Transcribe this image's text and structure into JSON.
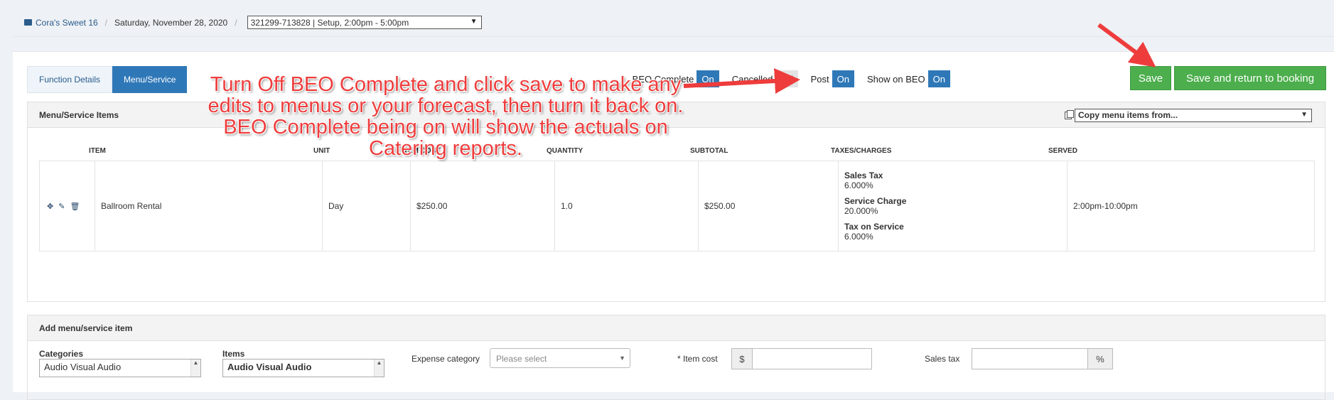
{
  "breadcrumb": {
    "booking": "Cora's Sweet 16",
    "date": "Saturday, November 28, 2020",
    "function_select": "321299-713828 | Setup, 2:00pm - 5:00pm"
  },
  "tabs": [
    {
      "label": "Function Details",
      "active": false
    },
    {
      "label": "Menu/Service",
      "active": true
    }
  ],
  "toggles": [
    {
      "label": "BEO Complete",
      "state": "On"
    },
    {
      "label": "Cancelled",
      "state": "Off"
    },
    {
      "label": "Post",
      "state": "On"
    },
    {
      "label": "Show on BEO",
      "state": "On"
    }
  ],
  "buttons": {
    "save": "Save",
    "save_return": "Save and return to booking"
  },
  "menu_panel": {
    "title": "Menu/Service Items",
    "copy_select": "Copy menu items from...",
    "columns": [
      "ITEM",
      "UNIT",
      "ITEM COST",
      "QUANTITY",
      "SUBTOTAL",
      "TAXES/CHARGES",
      "SERVED"
    ],
    "rows": [
      {
        "item": "Ballroom Rental",
        "unit": "Day",
        "item_cost": "$250.00",
        "quantity": "1.0",
        "subtotal": "$250.00",
        "taxes": [
          {
            "name": "Sales Tax",
            "value": "6.000%"
          },
          {
            "name": "Service Charge",
            "value": "20.000%"
          },
          {
            "name": "Tax on Service",
            "value": "6.000%"
          }
        ],
        "served": "2:00pm-10:00pm"
      }
    ]
  },
  "add_panel": {
    "title": "Add menu/service item",
    "categories_label": "Categories",
    "categories_value": "Audio Visual Audio",
    "items_label": "Items",
    "items_value": "Audio Visual Audio",
    "expense_label": "Expense category",
    "expense_placeholder": "Please select",
    "item_cost_label": "* Item cost",
    "currency_symbol": "$",
    "sales_tax_label": "Sales tax",
    "percent_symbol": "%"
  },
  "annotation": {
    "text": "Turn Off BEO Complete and click save to make any edits to menus or your forecast, then turn it back on.  BEO Complete being on will show the actuals on Catering reports.",
    "color": "#ee3c3c"
  },
  "colors": {
    "primary": "#2f78b8",
    "success": "#4cae4c",
    "link": "#2a5b8c"
  }
}
